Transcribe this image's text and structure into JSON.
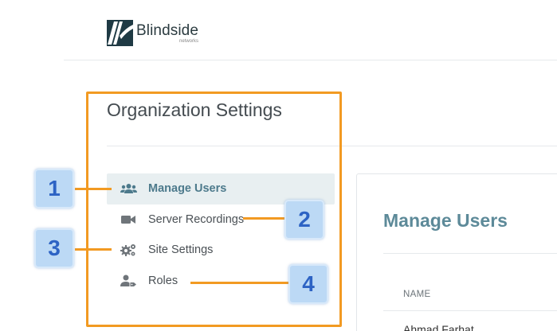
{
  "header": {
    "brand_name": "Blindside",
    "brand_sub": "networks",
    "logo_color": "#1f3a44"
  },
  "settings": {
    "title": "Organization Settings",
    "nav": [
      {
        "label": "Manage Users",
        "icon": "users-icon",
        "active": true
      },
      {
        "label": "Server Recordings",
        "icon": "video-camera-icon",
        "active": false
      },
      {
        "label": "Site Settings",
        "icon": "gears-icon",
        "active": false
      },
      {
        "label": "Roles",
        "icon": "user-tag-icon",
        "active": false
      }
    ]
  },
  "manage_users": {
    "title": "Manage Users",
    "columns": [
      "NAME"
    ],
    "rows": [
      {
        "name": "Ahmad Farhat"
      }
    ]
  },
  "annotations": {
    "badges": [
      "1",
      "2",
      "3",
      "4"
    ],
    "accent_color": "#f29a22",
    "badge_color": "#bcd9f5"
  }
}
